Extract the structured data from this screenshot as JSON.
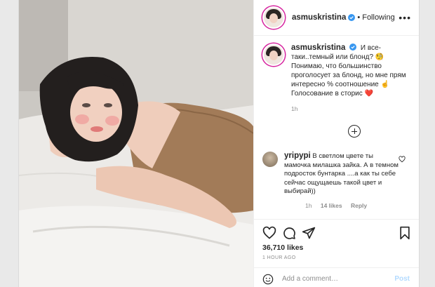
{
  "post": {
    "username": "asmuskristina",
    "follow_status": "Following",
    "dot": "•",
    "more_label": "•••",
    "caption": "И все-таки..темный или блонд? 🧐 Понимаю, что большинство проголосует за блонд, но мне прям интересно % соотношение ☝️ Голосование в сторис ❤️",
    "caption_time": "1h",
    "likes": "36,710 likes",
    "time_ago": "1 HOUR AGO"
  },
  "comment": {
    "username": "yripypi",
    "text": "В светлом цвете ты мамочка милашка зайка. А в темном подросток бунтарка ....а как ты себе сейчас ощущаешь такой цвет и выбирай))",
    "time": "1h",
    "likes": "14 likes",
    "reply": "Reply"
  },
  "add_comment": {
    "placeholder": "Add a comment…",
    "post_label": "Post"
  },
  "colors": {
    "verified": "#3897f0",
    "post_button": "#b3dbff",
    "muted": "#8e8e8e"
  },
  "icons": [
    "verified-badge-icon",
    "add-comments-icon",
    "small-heart-icon",
    "heart-icon",
    "comment-icon",
    "share-icon",
    "bookmark-icon",
    "emoji-icon"
  ]
}
